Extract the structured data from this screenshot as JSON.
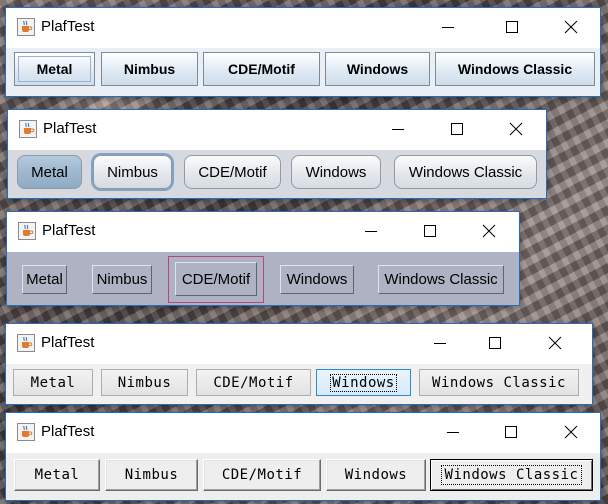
{
  "windows": [
    {
      "laf": "Metal",
      "title": "PlafTest",
      "buttons": [
        "Metal",
        "Nimbus",
        "CDE/Motif",
        "Windows",
        "Windows Classic"
      ],
      "focused_button": "Metal",
      "content_background": "#e9eff5"
    },
    {
      "laf": "Nimbus",
      "title": "PlafTest",
      "buttons": [
        "Metal",
        "Nimbus",
        "CDE/Motif",
        "Windows",
        "Windows Classic"
      ],
      "focused_button": "Nimbus",
      "content_background": "#d6d9df"
    },
    {
      "laf": "CDE/Motif",
      "title": "PlafTest",
      "buttons": [
        "Metal",
        "Nimbus",
        "CDE/Motif",
        "Windows",
        "Windows Classic"
      ],
      "focused_button": "CDE/Motif",
      "content_background": "#aeb2c3"
    },
    {
      "laf": "Windows",
      "title": "PlafTest",
      "buttons": [
        "Metal",
        "Nimbus",
        "CDE/Motif",
        "Windows",
        "Windows Classic"
      ],
      "focused_button": "Windows",
      "content_background": "#f0f0f0"
    },
    {
      "laf": "Windows Classic",
      "title": "PlafTest",
      "buttons": [
        "Metal",
        "Nimbus",
        "CDE/Motif",
        "Windows",
        "Windows Classic"
      ],
      "focused_button": "Windows Classic",
      "content_background": "#eeeeee"
    }
  ],
  "icons": {
    "app": "java-coffee-cup-icon",
    "minimize": "minimize-icon",
    "maximize": "maximize-icon",
    "close": "close-icon"
  },
  "colors": {
    "window_border": "#1e6fbf",
    "motif_focus": "#b24a73",
    "windows_focus": "#2d8ad6"
  }
}
